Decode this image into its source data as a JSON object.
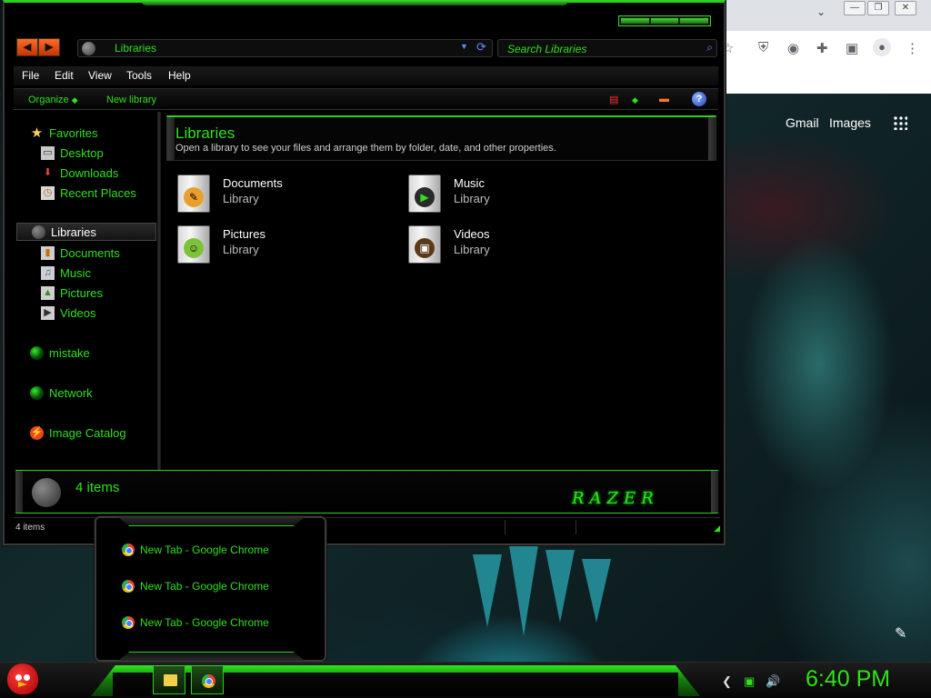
{
  "explorer": {
    "address": "Libraries",
    "search_placeholder": "Search Libraries",
    "menu": [
      "File",
      "Edit",
      "View",
      "Tools",
      "Help"
    ],
    "commands": {
      "organize": "Organize",
      "new_library": "New library"
    },
    "nav": {
      "favorites_header": "Favorites",
      "favorites": [
        "Desktop",
        "Downloads",
        "Recent Places"
      ],
      "libraries_header": "Libraries",
      "libraries": [
        "Documents",
        "Music",
        "Pictures",
        "Videos"
      ],
      "others": [
        "mistake",
        "Network",
        "Image Catalog"
      ]
    },
    "content": {
      "title": "Libraries",
      "subtitle": "Open a library to see your files and arrange them by folder, date, and other properties.",
      "items": [
        {
          "name": "Documents",
          "type": "Library"
        },
        {
          "name": "Music",
          "type": "Library"
        },
        {
          "name": "Pictures",
          "type": "Library"
        },
        {
          "name": "Videos",
          "type": "Library"
        }
      ]
    },
    "details_count": "4 items",
    "brand_logo": "RAZER",
    "status_text": "4 items"
  },
  "chrome": {
    "links": [
      "Gmail",
      "Images"
    ]
  },
  "taskbar_popup": {
    "items": [
      "New Tab - Google Chrome",
      "New Tab - Google Chrome",
      "New Tab - Google Chrome"
    ]
  },
  "taskbar": {
    "clock": "6:40 PM"
  },
  "colors": {
    "accent_green": "#2fe11c",
    "window_bg": "#000000"
  }
}
